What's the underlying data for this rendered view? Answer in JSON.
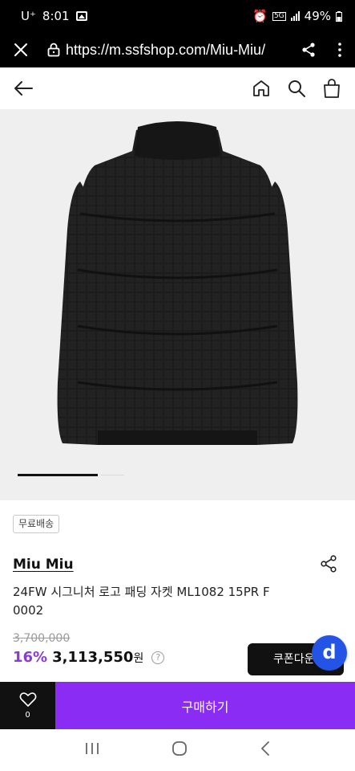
{
  "status_bar": {
    "carrier": "U⁺",
    "time": "8:01",
    "signal_label": "5G",
    "battery": "49%"
  },
  "browser": {
    "url": "https://m.ssfshop.com/Miu-Miu/"
  },
  "product": {
    "badge": "무료배송",
    "brand": "Miu Miu",
    "name": "24FW 시그니처 로고 패딩 자켓 ML1082 15PR F 0002",
    "original_price": "3,700,000",
    "discount": "16%",
    "price": "3,113,550",
    "currency": "원",
    "help_glyph": "?",
    "coupon_label": "쿠폰다운",
    "image_progress": 0.75
  },
  "fab": {
    "label": "d",
    "color": "#2454e6"
  },
  "actions": {
    "wish_count": "0",
    "buy_label": "구매하기",
    "buy_color": "#8b2cf5"
  },
  "icons": [
    "close-icon",
    "lock-icon",
    "share-icon",
    "more-icon",
    "back-arrow-icon",
    "home-icon",
    "search-icon",
    "shopping-bag-icon",
    "heart-icon",
    "recent-apps-icon",
    "home-circle-icon",
    "back-icon"
  ]
}
